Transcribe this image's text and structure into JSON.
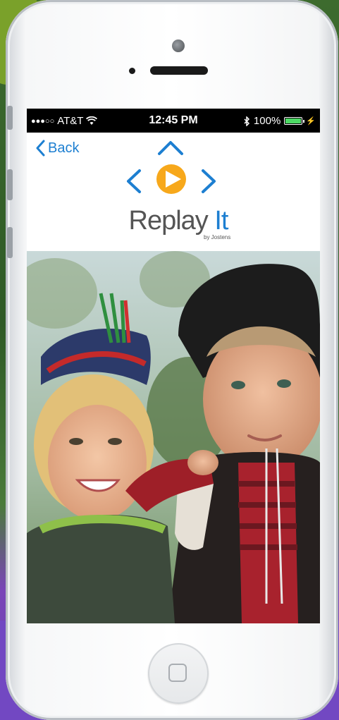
{
  "status_bar": {
    "carrier": "AT&T",
    "time": "12:45 PM",
    "battery": "100%",
    "battery_level": 1.0
  },
  "nav": {
    "back_label": "Back"
  },
  "logo": {
    "name_part1": "Replay ",
    "name_part2": "It",
    "byline": "by Jostens"
  },
  "colors": {
    "accent_blue": "#1d7fd1",
    "play_orange": "#f7a81b",
    "leaf_green": "#7aa12a",
    "bg_purple": "#7248c2"
  },
  "icons": [
    "back-chevron-icon",
    "wifi-icon",
    "bluetooth-icon",
    "battery-icon",
    "up-arrow-icon",
    "left-arrow-icon",
    "right-arrow-icon",
    "play-icon",
    "home-button-icon"
  ]
}
